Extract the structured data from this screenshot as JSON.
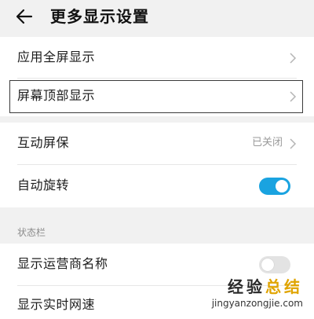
{
  "header": {
    "back_icon": "arrow-left-icon",
    "title": "更多显示设置"
  },
  "rows": {
    "fullscreen_apps": {
      "label": "应用全屏显示",
      "icon": "chevron-right-icon"
    },
    "top_display": {
      "label": "屏幕顶部显示",
      "icon": "chevron-right-icon"
    },
    "screensaver": {
      "label": "互动屏保",
      "value": "已关闭",
      "icon": "chevron-right-icon"
    },
    "auto_rotate": {
      "label": "自动旋转",
      "toggle": true
    }
  },
  "status_bar": {
    "section_label": "状态栏",
    "carrier_name": {
      "label": "显示运营商名称",
      "toggle": false
    },
    "realtime_speed": {
      "label": "显示实时网速"
    }
  },
  "watermark": {
    "title_a": "经验",
    "title_b": "总结",
    "url": "jingyanzongjie.com"
  },
  "colors": {
    "toggle_on": "#1aa3e0",
    "toggle_off": "#e3e3e3",
    "watermark_accent": "#e0a400"
  }
}
